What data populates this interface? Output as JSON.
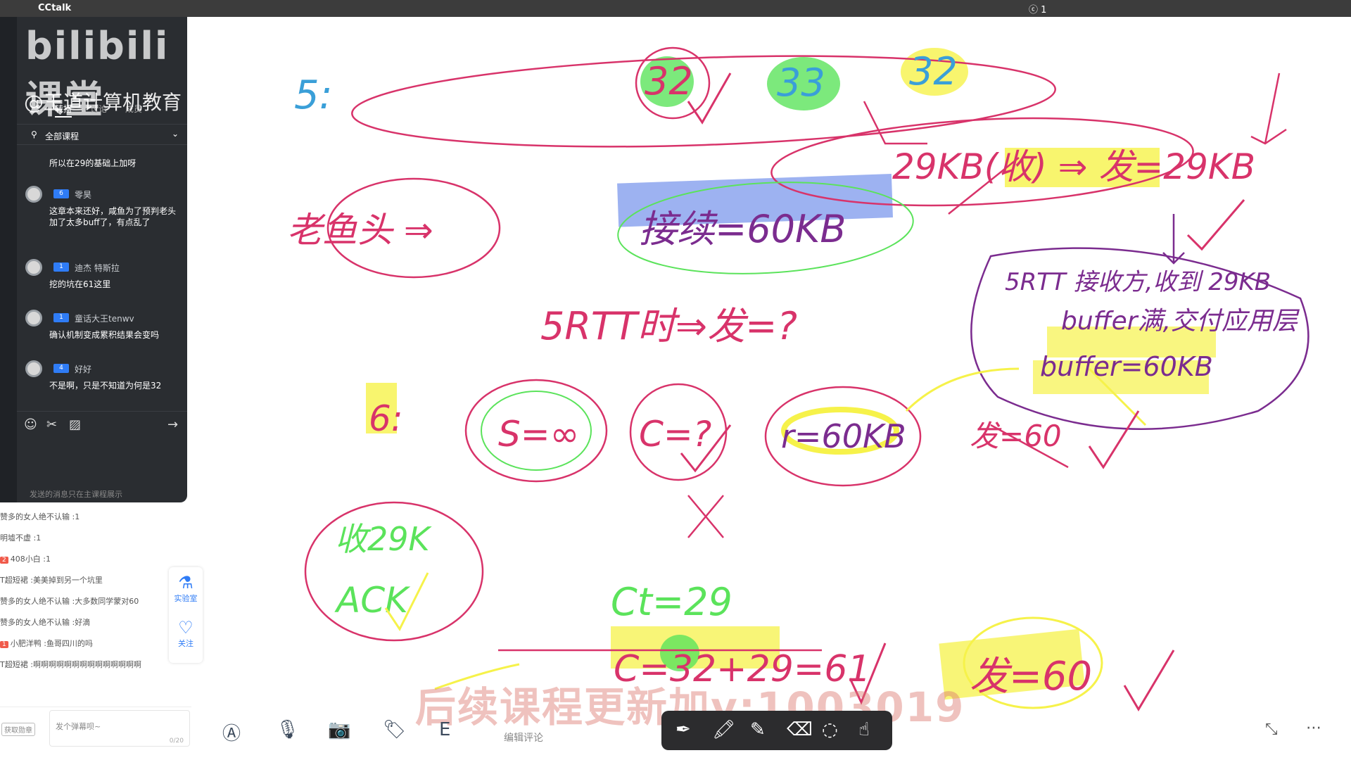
{
  "menubar": {
    "app_name": "CCtalk",
    "status_count": "1"
  },
  "chat": {
    "logo": "bilibili课堂",
    "watermark": "@王道计算机教育",
    "tabs": [
      "转播",
      "讨论",
      "成员"
    ],
    "filter_label": "全部课程",
    "messages": [
      {
        "name": "",
        "level": "",
        "text": "所以在29的基础上加呀"
      },
      {
        "name": "零昊",
        "level": "6",
        "text": "这章本来还好，咸鱼为了预判老头加了太多buff了，有点乱了"
      },
      {
        "name": "迪杰 特斯拉",
        "level": "1",
        "text": "挖的坑在61这里"
      },
      {
        "name": "童话大王tenwv",
        "level": "1",
        "text": "确认机制变成累积结果会变吗"
      },
      {
        "name": "好好",
        "level": "4",
        "text": "不是啊，只是不知道为何是32"
      }
    ],
    "footer_note": "发送的消息只在主课程展示"
  },
  "danmaku": [
    {
      "badge": "",
      "user": "赞多的女人绝不认输",
      "text": "1"
    },
    {
      "badge": "",
      "user": "明墟不虚",
      "text": "1"
    },
    {
      "badge": "2",
      "user": "408小白",
      "text": "1"
    },
    {
      "badge": "",
      "user": "T超短裙",
      "text": "美美掉到另一个坑里"
    },
    {
      "badge": "",
      "user": "赞多的女人绝不认输",
      "text": "大多数同学蒙对60"
    },
    {
      "badge": "",
      "user": "赞多的女人绝不认输",
      "text": "好滴"
    },
    {
      "badge": "1",
      "user": "小肥洋鸭",
      "text": "鱼哥四川的吗"
    },
    {
      "badge": "",
      "user": "T超短裙",
      "text": "啊啊啊啊啊啊啊啊啊啊啊啊啊啊"
    }
  ],
  "danmaku_input": {
    "medal": "获取勋章",
    "placeholder": "发个弹幕呗~",
    "counter": "0/20"
  },
  "side_buttons": {
    "lab": "实验室",
    "follow": "关注"
  },
  "toolbar": {
    "comment_label": "编辑评论"
  },
  "promo": "后续课程更新加v:1003019",
  "whiteboard": {
    "texts": [
      "5:",
      "32",
      "33",
      "32",
      "29KB(收) ⇒ 发=29KB",
      "老鱼头 ⇒",
      "接续=60KB",
      "5RTT 接收方,收到 29KB",
      "buffer满,交付应用层",
      "buffer=60KB",
      "5RTT时⇒发=?",
      "6:",
      "S=∞",
      "C=?",
      "r=60KB",
      "发=60",
      "收29K",
      "ACK",
      "Ct=29",
      "C=32+29=61",
      "发=60"
    ]
  },
  "colors": {
    "accent_blue": "#2f7cf6",
    "ink_pink": "#d8336a",
    "ink_purple": "#7b2c8f",
    "highlight_green": "#5be35b",
    "highlight_yellow": "#f6f24a",
    "highlight_blue": "#5b7ee8"
  }
}
